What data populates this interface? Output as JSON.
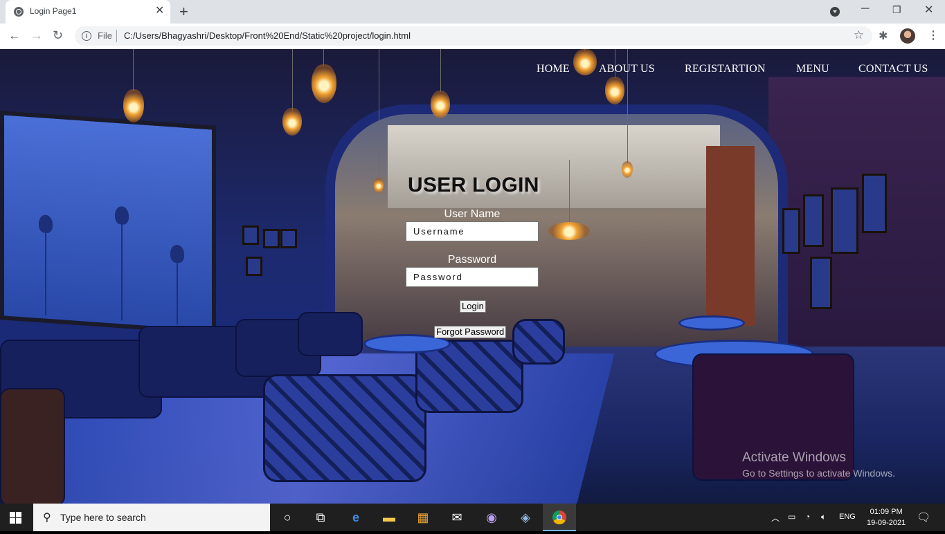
{
  "browser": {
    "tab_title": "Login Page1",
    "scheme_label": "File",
    "url": "C:/Users/Bhagyashri/Desktop/Front%20End/Static%20project/login.html"
  },
  "nav": {
    "items": [
      "HOME",
      "ABOUT US",
      "REGISTARTION",
      "MENU",
      "CONTACT US"
    ]
  },
  "login": {
    "title": "USER LOGIN",
    "username_label": "User Name",
    "username_placeholder": "Username",
    "password_label": "Password",
    "password_placeholder": "Password",
    "login_button": "Login",
    "forgot_button": "Forgot Password"
  },
  "watermark": {
    "line1": "Activate Windows",
    "line2": "Go to Settings to activate Windows."
  },
  "taskbar": {
    "search_placeholder": "Type here to search",
    "language": "ENG",
    "time": "01:09 PM",
    "date": "19-09-2021"
  }
}
